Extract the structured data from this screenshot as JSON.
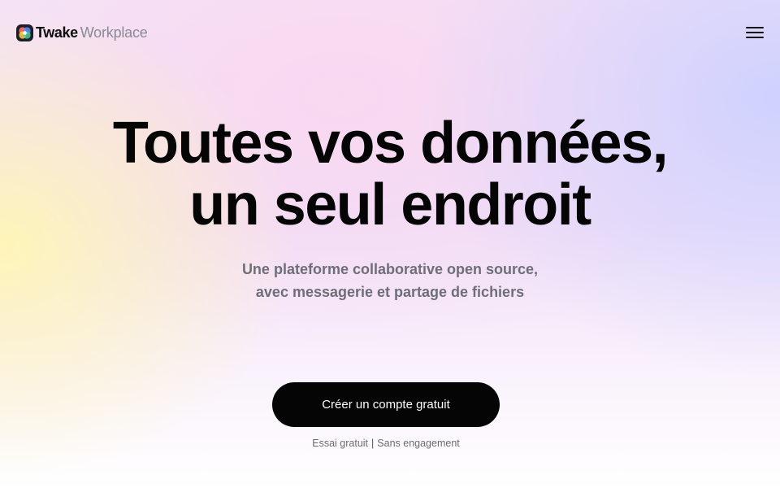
{
  "header": {
    "logo": {
      "icon": "twake-logo-icon",
      "brand": "Twake",
      "product": "Workplace"
    },
    "menu_icon": "hamburger-menu-icon"
  },
  "hero": {
    "title_line1": "Toutes vos données,",
    "title_line2": "un seul endroit",
    "subtitle_line1": "Une plateforme collaborative open source,",
    "subtitle_line2": "avec messagerie et partage de fichiers",
    "cta_label": "Créer un compte gratuit",
    "note_left": "Essai gratuit",
    "note_separator": "|",
    "note_right": "Sans engagement"
  },
  "colors": {
    "cta_background": "#050505",
    "cta_text": "#ffffff",
    "subtitle": "#6e6e78",
    "product_name": "#8a8a94"
  }
}
